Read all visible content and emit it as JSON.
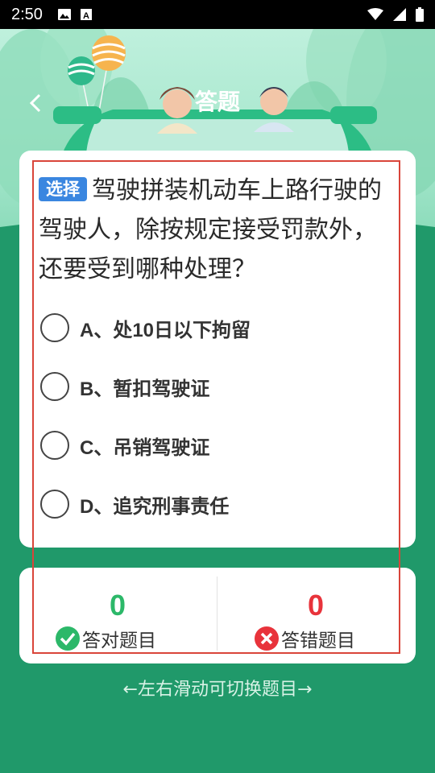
{
  "status_bar": {
    "time": "2:50",
    "icons": [
      "image-icon",
      "font-a-icon",
      "wifi-icon",
      "signal-icon",
      "battery-icon"
    ]
  },
  "header": {
    "title": "答题",
    "back_icon": "chevron-left-icon"
  },
  "question": {
    "type_badge": "选择",
    "text": "驾驶拼装机动车上路行驶的驾驶人，除按规定接受罚款外，还要受到哪种处理？",
    "options": [
      {
        "label": "A、处10日以下拘留",
        "selected": false
      },
      {
        "label": "B、暂扣驾驶证",
        "selected": false
      },
      {
        "label": "C、吊销驾驶证",
        "selected": false
      },
      {
        "label": "D、追究刑事责任",
        "selected": false
      }
    ]
  },
  "stats": {
    "correct": {
      "value": "0",
      "label": "答对题目",
      "icon": "check-circle-icon",
      "color": "#2cb869"
    },
    "wrong": {
      "value": "0",
      "label": "答错题目",
      "icon": "x-circle-icon",
      "color": "#e8333b"
    }
  },
  "footer": {
    "swipe_hint": "左右滑动可切换题目"
  },
  "colors": {
    "accent_green": "#20996a",
    "badge_blue": "#3a86e0",
    "frame_red": "#d9453a"
  }
}
